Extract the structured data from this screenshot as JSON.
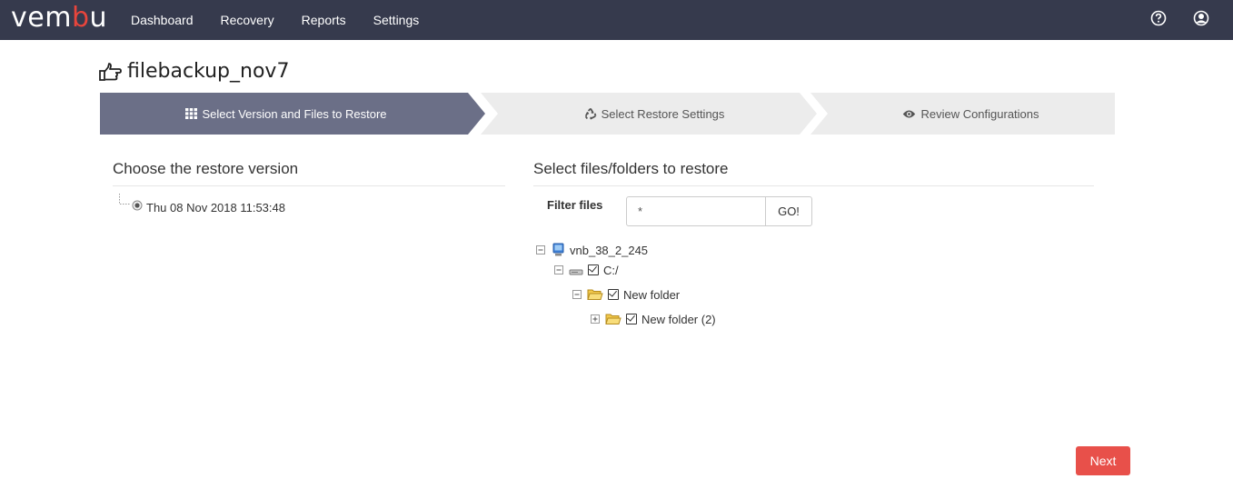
{
  "header": {
    "logo_prefix": "vem",
    "logo_accent": "b",
    "logo_suffix": "u",
    "nav": [
      "Dashboard",
      "Recovery",
      "Reports",
      "Settings"
    ]
  },
  "page": {
    "title": "filebackup_nov7",
    "title_icon": "hand-pointing-right-icon"
  },
  "wizard": {
    "steps": [
      {
        "label": "Select Version and Files to Restore",
        "icon": "grid-icon",
        "active": true
      },
      {
        "label": "Select Restore Settings",
        "icon": "recycle-icon",
        "active": false
      },
      {
        "label": "Review Configurations",
        "icon": "eye-icon",
        "active": false
      }
    ]
  },
  "left": {
    "title": "Choose the restore version",
    "versions": [
      {
        "label": "Thu 08 Nov 2018 11:53:48",
        "selected": true
      }
    ]
  },
  "right": {
    "title": "Select files/folders to restore",
    "filter_label": "Filter files",
    "filter_value": "*",
    "go_label": "GO!",
    "tree": [
      {
        "label": "vnb_38_2_245",
        "icon": "computer-icon",
        "checked": null
      },
      {
        "label": "C:/",
        "icon": "drive-icon",
        "checked": true
      },
      {
        "label": "New folder",
        "icon": "folder-icon",
        "checked": true
      },
      {
        "label": "New folder (2)",
        "icon": "folder-icon",
        "checked": true
      }
    ]
  },
  "footer": {
    "next_label": "Next"
  },
  "colors": {
    "topbar": "#363a4d",
    "active_step": "#6b6f87",
    "inactive_step": "#ececec",
    "next_button": "#e8504a",
    "logo_accent": "#e8453c"
  }
}
